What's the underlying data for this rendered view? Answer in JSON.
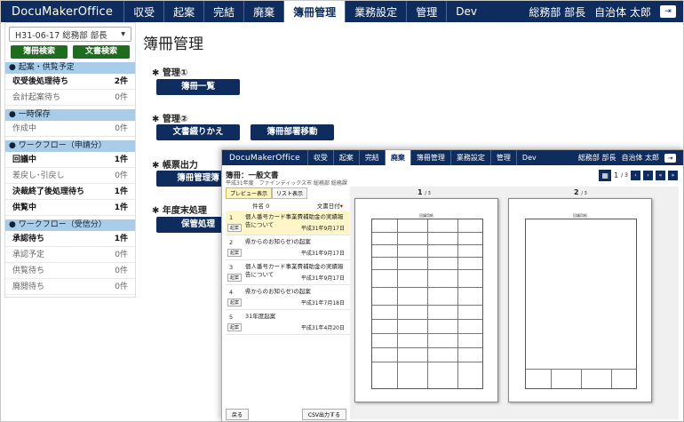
{
  "back": {
    "nav": {
      "brand": "DocuMakerOffice",
      "items": [
        "収受",
        "起案",
        "完結",
        "廃棄",
        "簿冊管理",
        "業務設定",
        "管理",
        "Dev"
      ],
      "active_index": 4,
      "dept": "総務部 部長",
      "user": "自治体 太郎"
    },
    "sidebar": {
      "select_value": "H31-06-17 総務部 部長",
      "buttons": [
        "簿冊検索",
        "文書検索"
      ],
      "sections": [
        {
          "title": "● 起案・供覧予定",
          "rows": [
            {
              "label": "収受後処理待ち",
              "count": "2件",
              "bold": true
            },
            {
              "label": "会計起案待ち",
              "count": "0件",
              "bold": false
            }
          ]
        },
        {
          "title": "● 一時保存",
          "rows": [
            {
              "label": "作成中",
              "count": "0件",
              "bold": false
            }
          ]
        },
        {
          "title": "● ワークフロー（申請分）",
          "rows": [
            {
              "label": "回議中",
              "count": "1件",
              "bold": true
            },
            {
              "label": "差戻し･引戻し",
              "count": "0件",
              "bold": false
            },
            {
              "label": "決裁終了後処理待ち",
              "count": "1件",
              "bold": true
            },
            {
              "label": "供覧中",
              "count": "1件",
              "bold": true
            }
          ]
        },
        {
          "title": "● ワークフロー（受信分）",
          "rows": [
            {
              "label": "承認待ち",
              "count": "1件",
              "bold": true
            },
            {
              "label": "承認予定",
              "count": "0件",
              "bold": false
            },
            {
              "label": "供覧待ち",
              "count": "0件",
              "bold": false
            },
            {
              "label": "廃閲待ち",
              "count": "0件",
              "bold": false
            }
          ]
        }
      ]
    },
    "main": {
      "title": "簿冊管理",
      "groups": [
        {
          "label": "✱ 管理①",
          "buttons": [
            "簿冊一覧"
          ]
        },
        {
          "label": "✱ 管理②",
          "buttons": [
            "文書綴りかえ",
            "簿冊部署移動"
          ]
        },
        {
          "label": "✱ 帳票出力",
          "buttons": [
            "簿冊管理簿"
          ]
        },
        {
          "label": "✱ 年度末処理",
          "buttons": [
            "保管処理"
          ]
        }
      ]
    }
  },
  "front": {
    "nav": {
      "brand": "DocuMakerOffice",
      "items": [
        "収受",
        "起案",
        "完結",
        "廃棄",
        "簿冊管理",
        "業務設定",
        "管理",
        "Dev"
      ],
      "active_index": 3,
      "dept": "総務部 部長",
      "user": "自治体 太郎"
    },
    "doc_title": "簿冊：一般文書",
    "doc_sub": "平成31年度　ファインディックス市 総務部 総務課",
    "tabs": [
      "プレビュー表示",
      "リスト表示"
    ],
    "list_header": {
      "name": "件名",
      "name_icon": "0",
      "date": "文書日付"
    },
    "list": [
      {
        "num": "1",
        "title": "個人番号カード事業費補助金の実績報告について",
        "date": "平成31年9月17日",
        "tag": "起案",
        "hl": true
      },
      {
        "num": "2",
        "title": "県からのお知らせ)の起案",
        "date": "平成31年9月17日",
        "tag": "起案",
        "hl": false
      },
      {
        "num": "3",
        "title": "個人番号カード事業費補助金の実績報告について",
        "date": "平成31年9月17日",
        "tag": "起案",
        "hl": false
      },
      {
        "num": "4",
        "title": "県からのお知らせ)の起案",
        "date": "平成31年7月18日",
        "tag": "起案",
        "hl": false
      },
      {
        "num": "5",
        "title": "31年度起案",
        "date": "平成31年4月20日",
        "tag": "起案",
        "hl": false
      }
    ],
    "footer": [
      "戻る",
      "CSV出力する"
    ],
    "pager": {
      "current": "1",
      "total": "/ 3",
      "first": "«",
      "prev": "‹",
      "next": "›",
      "last": "»"
    },
    "pages": [
      {
        "no": "1",
        "of": "/ 3",
        "caption": "回議用紙"
      },
      {
        "no": "2",
        "of": "/ 3",
        "caption": "回議用紙"
      }
    ]
  }
}
